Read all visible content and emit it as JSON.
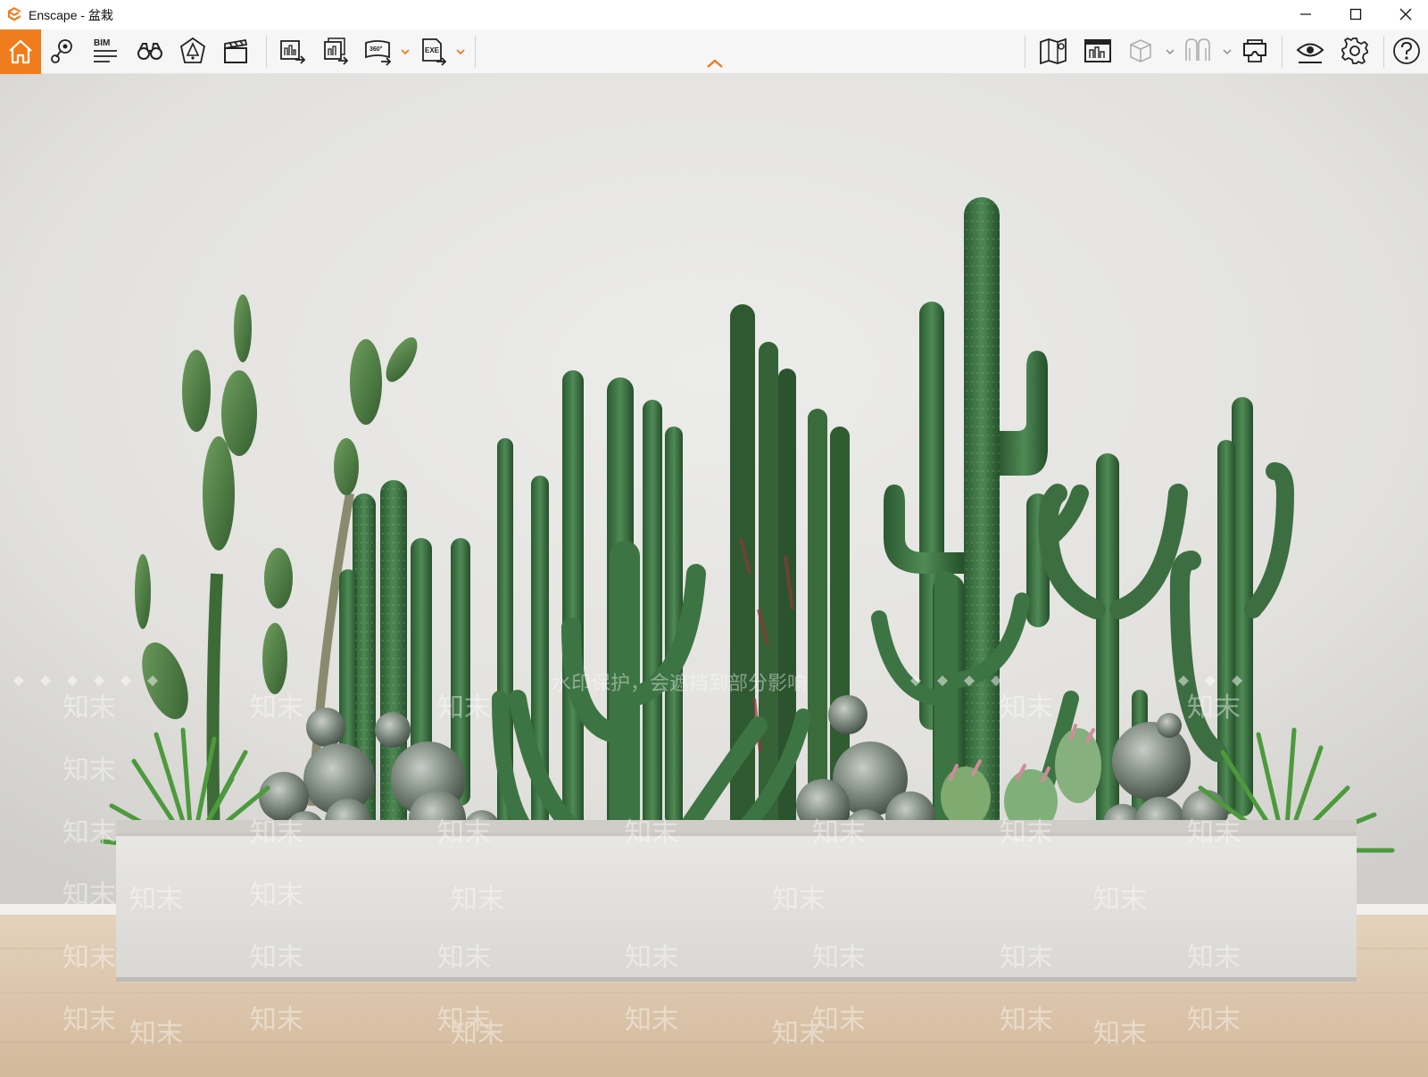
{
  "window": {
    "title": "Enscape - 盆栽",
    "controls": {
      "minimize": "minimize-icon",
      "maximize": "maximize-icon",
      "close": "close-icon"
    }
  },
  "toolbar": {
    "accent": "#f07d1d",
    "left_tools": [
      {
        "name": "home",
        "icon": "home-icon",
        "active": true
      },
      {
        "name": "views",
        "icon": "location-pin-icon"
      },
      {
        "name": "bim",
        "icon": "bim-icon",
        "label": "BIM"
      },
      {
        "name": "walk",
        "icon": "binoculars-icon"
      },
      {
        "name": "light",
        "icon": "light-view-icon"
      },
      {
        "name": "video",
        "icon": "clapperboard-icon"
      },
      {
        "name": "render-image",
        "icon": "image-export-icon"
      },
      {
        "name": "batch-render",
        "icon": "batch-export-icon"
      },
      {
        "name": "panorama",
        "icon": "panorama-export-icon",
        "label": "360°"
      },
      {
        "name": "exe",
        "icon": "exe-export-icon",
        "label": "EXE"
      }
    ],
    "right_tools": [
      {
        "name": "map",
        "icon": "map-icon"
      },
      {
        "name": "capture",
        "icon": "capture-panel-icon"
      },
      {
        "name": "asset",
        "icon": "cube-icon"
      },
      {
        "name": "collab",
        "icon": "collaboration-icon"
      },
      {
        "name": "vr",
        "icon": "vr-headset-icon"
      },
      {
        "name": "visual",
        "icon": "eye-icon"
      },
      {
        "name": "settings",
        "icon": "gear-icon"
      },
      {
        "name": "help",
        "icon": "help-icon"
      }
    ]
  },
  "viewport": {
    "watermark_text": "知末",
    "watermark_notice": "水印保护，会遮挡到部分影响"
  }
}
